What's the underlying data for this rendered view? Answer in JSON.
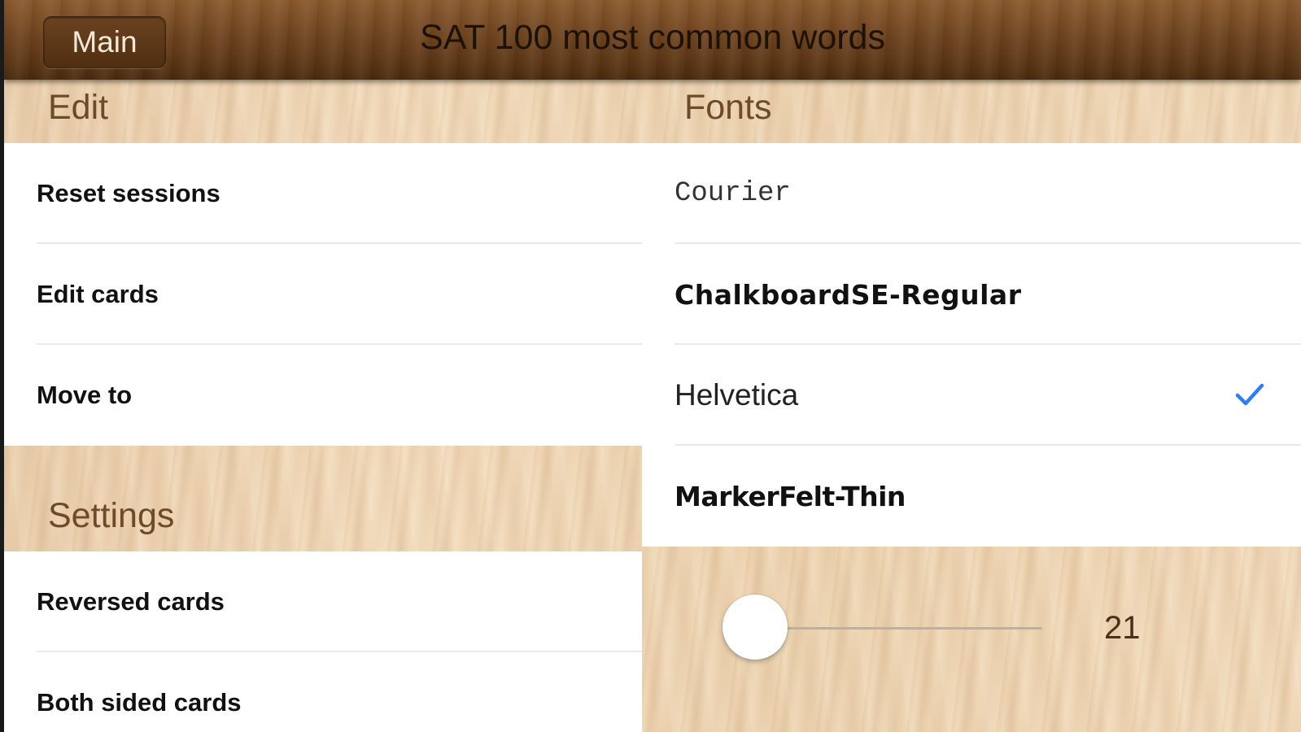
{
  "navbar": {
    "back_label": "Main",
    "title": "SAT 100 most common words"
  },
  "edit": {
    "header": "Edit",
    "items": [
      {
        "label": "Reset sessions"
      },
      {
        "label": "Edit cards"
      },
      {
        "label": "Move to"
      }
    ]
  },
  "settings": {
    "header": "Settings",
    "items": [
      {
        "label": "Reversed cards"
      },
      {
        "label": "Both sided cards"
      }
    ]
  },
  "fonts": {
    "header": "Fonts",
    "items": [
      {
        "label": "Courier",
        "selected": false
      },
      {
        "label": "ChalkboardSE-Regular",
        "selected": false
      },
      {
        "label": "Helvetica",
        "selected": true
      },
      {
        "label": "MarkerFelt-Thin",
        "selected": false
      }
    ],
    "check_icon": "checkmark-icon"
  },
  "font_size": {
    "value": "21",
    "fraction": 0.05
  },
  "colors": {
    "navbar": "#5a3515",
    "accent": "#2f7cf6",
    "section_header": "#6e4a26"
  }
}
